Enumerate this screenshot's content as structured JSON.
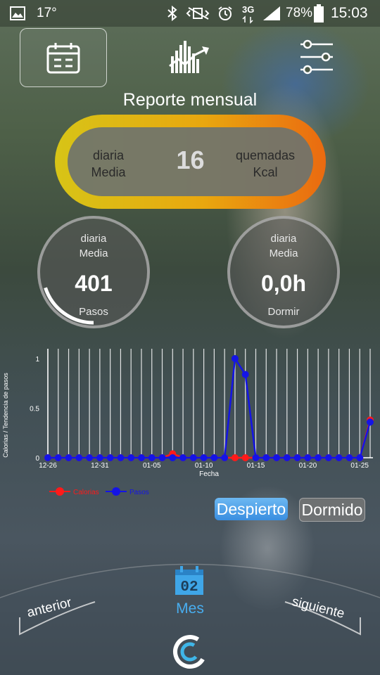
{
  "status": {
    "temperature": "17°",
    "network": "3G",
    "battery": "78%",
    "time": "15:03"
  },
  "header": {
    "title": "Reporte mensual"
  },
  "calories": {
    "label_left_1": "diaria",
    "label_left_2": "Media",
    "value": "16",
    "label_right_1": "quemadas",
    "label_right_2": "Kcal"
  },
  "steps": {
    "label_1": "diaria",
    "label_2": "Media",
    "value": "401",
    "unit": "Pasos",
    "progress": 0.2
  },
  "sleep": {
    "label_1": "diaria",
    "label_2": "Media",
    "value": "0,0h",
    "unit": "Dormir"
  },
  "chart_data": {
    "type": "line",
    "ylabel": "Calorias / Tendencia de pasos",
    "xlabel": "Fecha",
    "ylim": [
      0,
      1
    ],
    "yticks": [
      "1",
      "0.5",
      "0"
    ],
    "xticks": [
      {
        "index": 0,
        "label": "12-26"
      },
      {
        "index": 5,
        "label": "12-31"
      },
      {
        "index": 10,
        "label": "01-05"
      },
      {
        "index": 15,
        "label": "01-10"
      },
      {
        "index": 20,
        "label": "01-15"
      },
      {
        "index": 25,
        "label": "01-20"
      },
      {
        "index": 30,
        "label": "01-25"
      }
    ],
    "series": [
      {
        "name": "Calorias",
        "color": "#ff1a1a",
        "values": [
          0,
          0,
          0,
          0,
          0,
          0,
          0,
          0,
          0,
          0,
          0,
          0,
          0.04,
          0,
          0,
          0,
          0,
          0,
          0,
          0,
          0,
          0,
          0,
          0,
          0,
          0,
          0,
          0,
          0,
          0,
          0,
          0.38
        ]
      },
      {
        "name": "Pasos",
        "color": "#1414e6",
        "values": [
          0,
          0,
          0,
          0,
          0,
          0,
          0,
          0,
          0,
          0,
          0,
          0,
          0,
          0,
          0,
          0,
          0,
          0,
          1,
          0.84,
          0,
          0,
          0,
          0,
          0,
          0,
          0,
          0,
          0,
          0,
          0,
          0.36
        ]
      }
    ]
  },
  "controls": {
    "awake": "Despierto",
    "asleep": "Dormido"
  },
  "nav": {
    "prev": "anterior",
    "current": "Mes",
    "next": "siguiente",
    "calendar_day": "02"
  }
}
